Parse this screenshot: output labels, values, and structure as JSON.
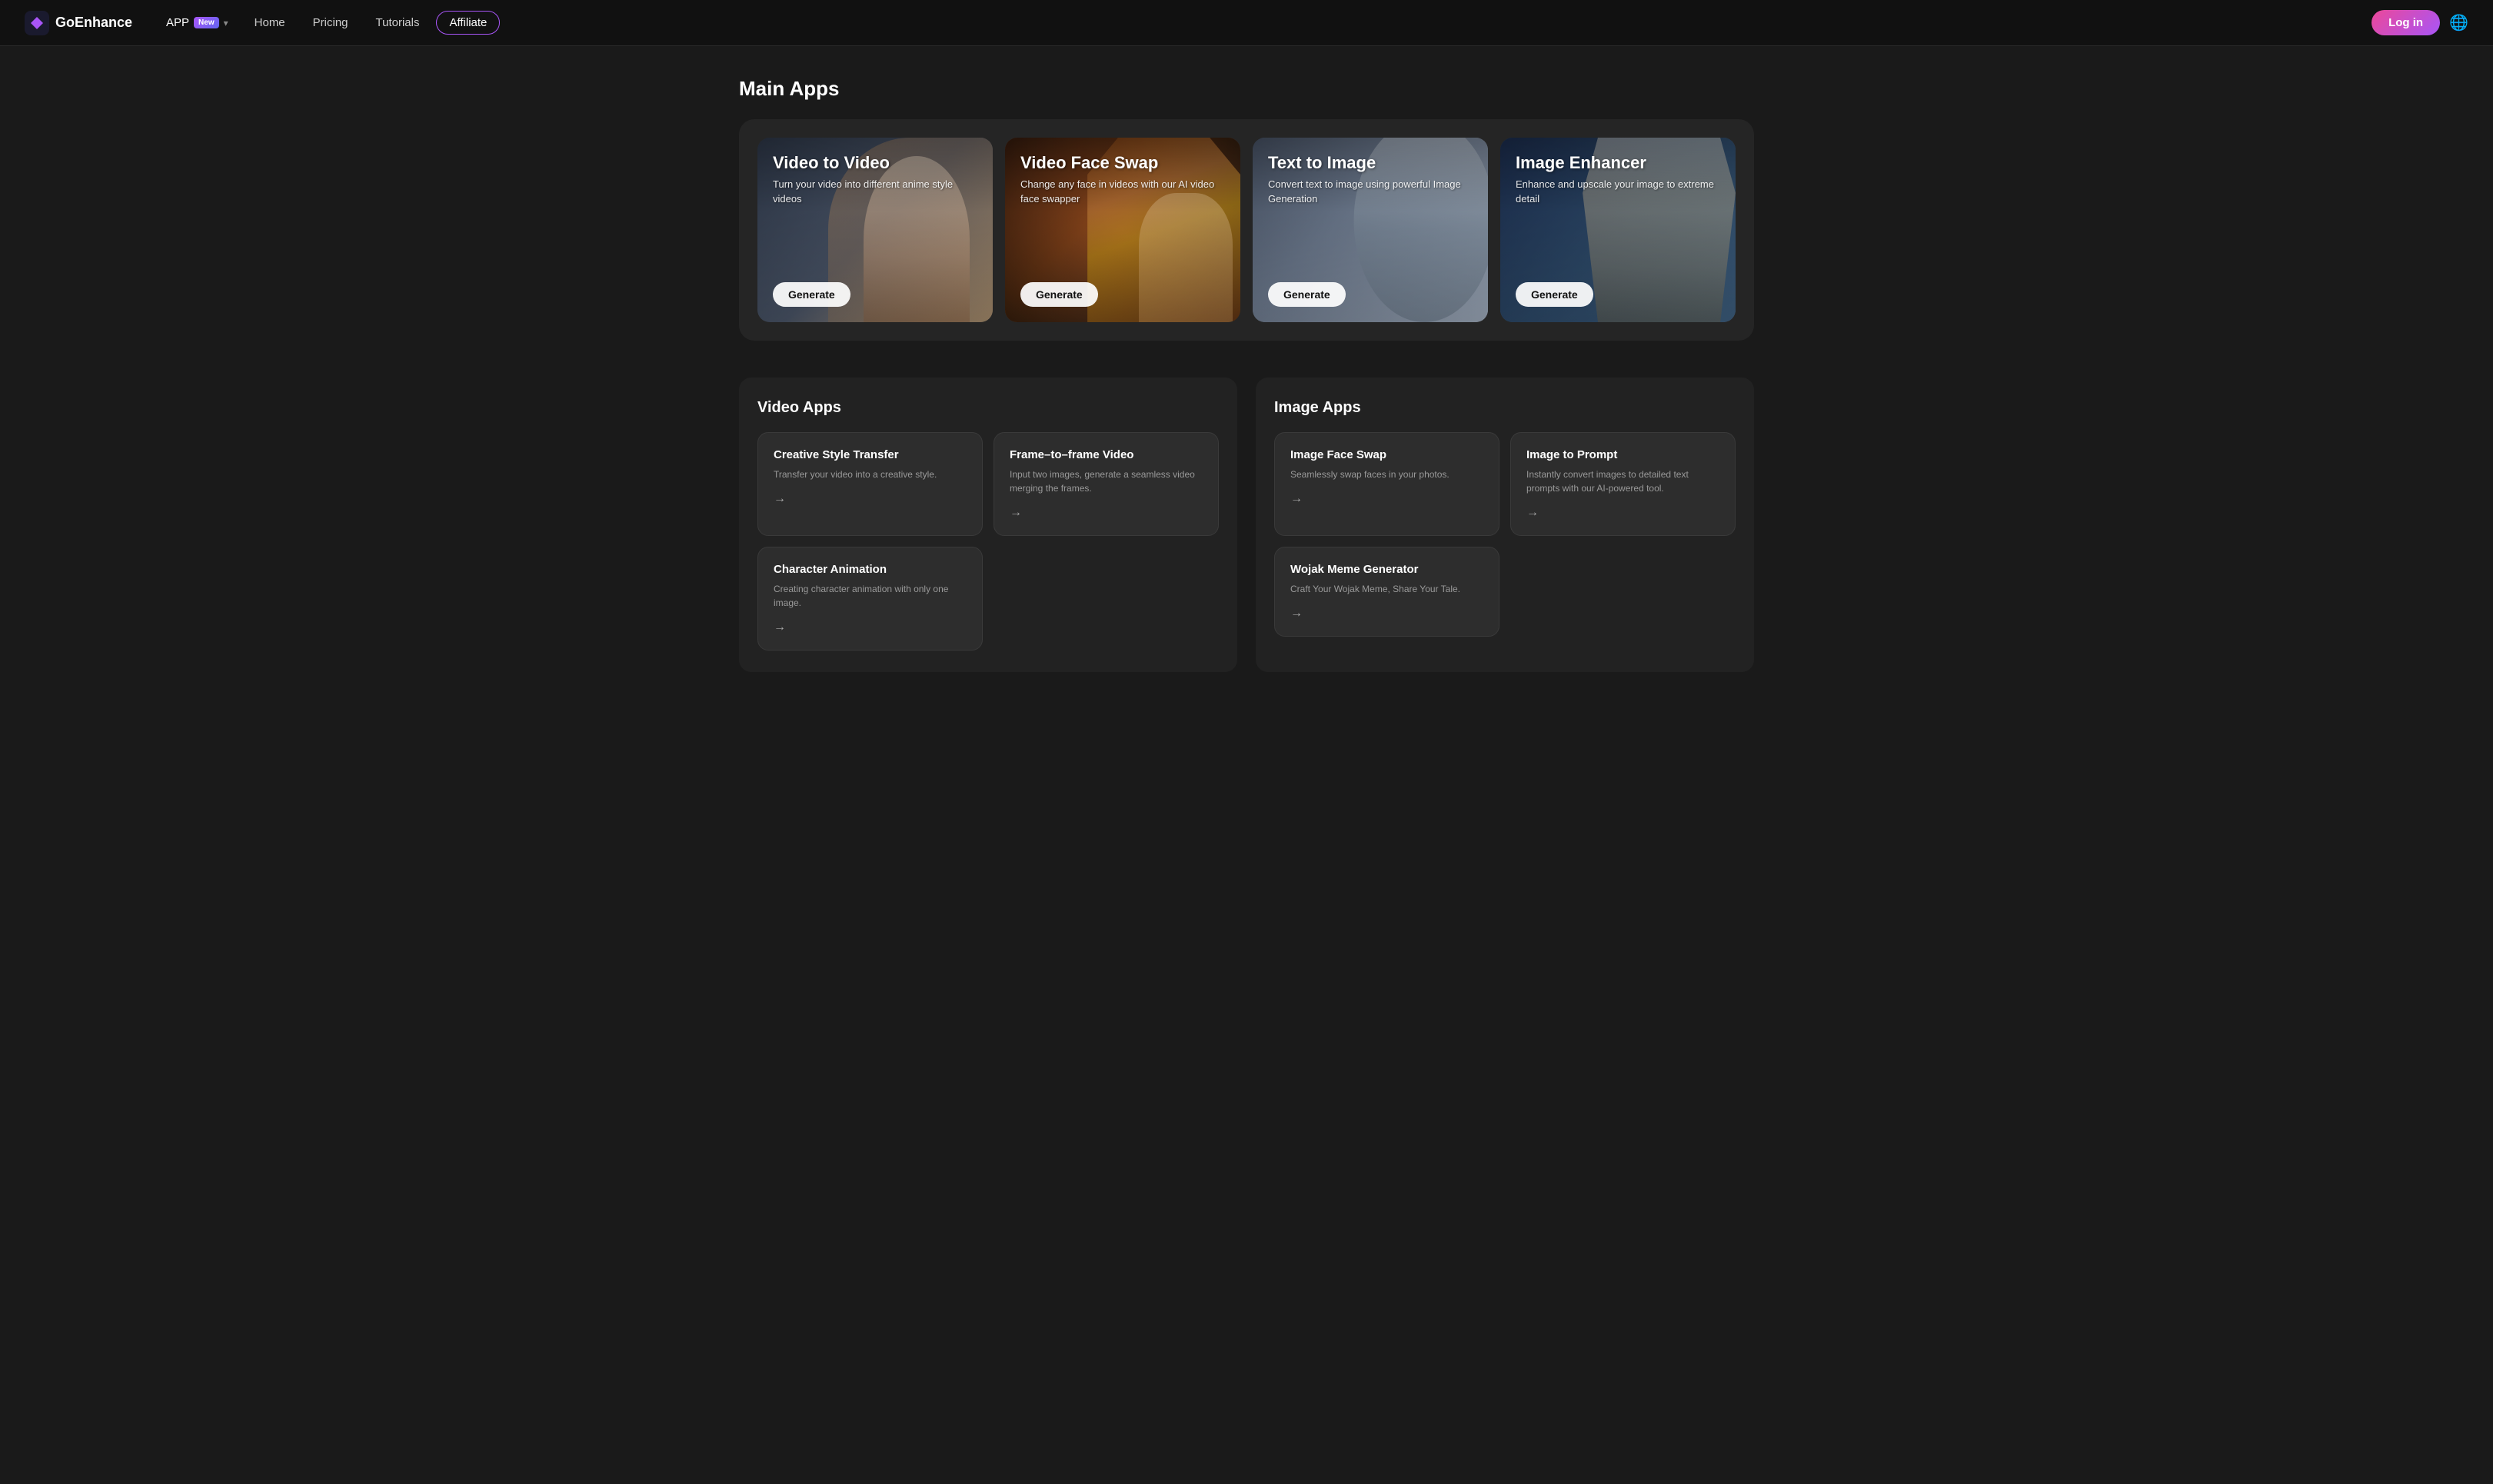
{
  "logo": {
    "name": "GoEnhance",
    "icon": "✦"
  },
  "navbar": {
    "app_label": "APP",
    "app_badge": "New",
    "home": "Home",
    "pricing": "Pricing",
    "tutorials": "Tutorials",
    "affiliate": "Affiliate",
    "login": "Log in",
    "globe_icon": "🌐"
  },
  "main_section": {
    "title": "Main Apps",
    "cards": [
      {
        "id": "video-to-video",
        "title": "Video to Video",
        "description": "Turn your video into different anime style videos",
        "button": "Generate",
        "theme": "v2v"
      },
      {
        "id": "video-face-swap",
        "title": "Video Face Swap",
        "description": "Change any face in videos with our AI video face swapper",
        "button": "Generate",
        "theme": "vfs"
      },
      {
        "id": "text-to-image",
        "title": "Text to Image",
        "description": "Convert text to image using powerful Image Generation",
        "button": "Generate",
        "theme": "t2i"
      },
      {
        "id": "image-enhancer",
        "title": "Image Enhancer",
        "description": "Enhance and upscale your image to extreme detail",
        "button": "Generate",
        "theme": "ie"
      }
    ]
  },
  "video_apps": {
    "title": "Video Apps",
    "cards": [
      {
        "title": "Creative Style Transfer",
        "description": "Transfer your video into a creative style.",
        "arrow": "→"
      },
      {
        "title": "Frame–to–frame Video",
        "description": "Input two images, generate a seamless video merging the frames.",
        "arrow": "→"
      },
      {
        "title": "Character Animation",
        "description": "Creating character animation with only one image.",
        "arrow": "→"
      }
    ]
  },
  "image_apps": {
    "title": "Image Apps",
    "cards": [
      {
        "title": "Image Face Swap",
        "description": "Seamlessly swap faces in your photos.",
        "arrow": "→"
      },
      {
        "title": "Image to Prompt",
        "description": "Instantly convert images to detailed text prompts with our AI-powered tool.",
        "arrow": "→"
      },
      {
        "title": "Wojak Meme Generator",
        "description": "Craft Your Wojak Meme, Share Your Tale.",
        "arrow": "→"
      }
    ]
  }
}
